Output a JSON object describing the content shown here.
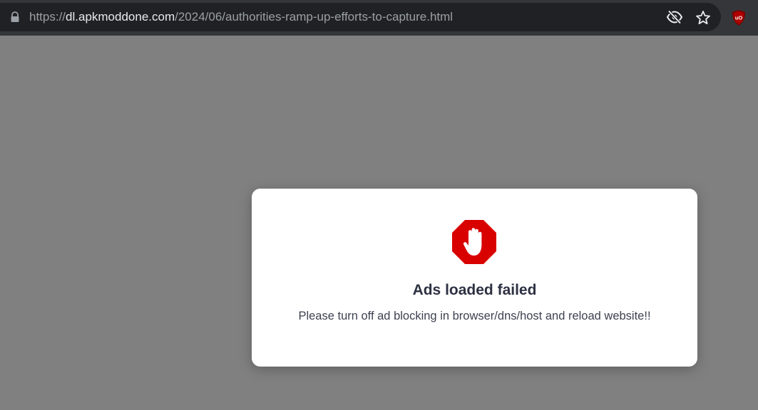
{
  "browser": {
    "url_scheme": "https://",
    "url_host": "dl.apkmoddone.com",
    "url_path": "/2024/06/authorities-ramp-up-efforts-to-capture.html",
    "icons": {
      "lock": "lock-icon",
      "tracking": "eye-slash-icon",
      "bookmark": "star-icon",
      "extension": "ublock-origin-icon"
    }
  },
  "modal": {
    "icon": "stop-hand-icon",
    "title": "Ads loaded failed",
    "message": "Please turn off ad blocking in browser/dns/host and reload website!!"
  },
  "colors": {
    "toolbar": "#35363a",
    "omnibox": "#202124",
    "overlay": "#808080",
    "stop_sign": "#d90000",
    "title_text": "#2d3142"
  }
}
